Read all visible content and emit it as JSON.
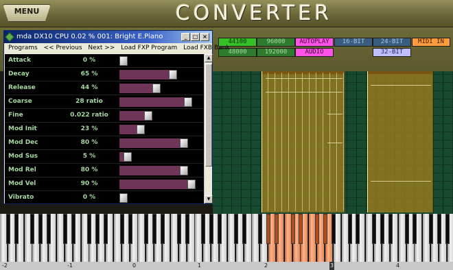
{
  "header": {
    "menu_label": "MENU",
    "title": "CONVERTER"
  },
  "options": {
    "row1": [
      "44100",
      "96000",
      "AUTOPLAY",
      "16-BIT",
      "24-BIT",
      "MIDI IN"
    ],
    "row2": [
      "48000",
      "192000",
      "AUDIO",
      "32-BIT"
    ],
    "selected": [
      "44100",
      "AUTOPLAY",
      "AUDIO",
      "32-BIT",
      "MIDI IN"
    ]
  },
  "plugin": {
    "title": "mda DX10   CPU  0.02 %   001: Bright E.Piano",
    "window_buttons": [
      "_",
      "□",
      "×"
    ],
    "menu": [
      "Programs",
      "<< Previous",
      "Next >>",
      "Load FXP Program",
      "Load FXB Bank"
    ],
    "params": [
      {
        "name": "Attack",
        "value": "0 %",
        "level": 0.0
      },
      {
        "name": "Decay",
        "value": "65 %",
        "level": 0.65
      },
      {
        "name": "Release",
        "value": "44 %",
        "level": 0.44
      },
      {
        "name": "Coarse",
        "value": "28 ratio",
        "level": 0.85
      },
      {
        "name": "Fine",
        "value": "0.022 ratio",
        "level": 0.33
      },
      {
        "name": "Mod Init",
        "value": "23 %",
        "level": 0.23
      },
      {
        "name": "Mod Dec",
        "value": "80 %",
        "level": 0.8
      },
      {
        "name": "Mod Sus",
        "value": "5 %",
        "level": 0.05
      },
      {
        "name": "Mod Rel",
        "value": "80 %",
        "level": 0.8
      },
      {
        "name": "Mod Vel",
        "value": "90 %",
        "level": 0.9
      },
      {
        "name": "Vibrato",
        "value": "0 %",
        "level": 0.0
      }
    ]
  },
  "keyboard": {
    "octave_labels": [
      "-2",
      "-1",
      "0",
      "1",
      "2",
      "3",
      "4"
    ],
    "highlighted_octave": "3"
  },
  "colors": {
    "grid": "#174a2e",
    "note_block": "#aa821e",
    "slider_fill": "#6f3558",
    "param_text": "#a8d9a2",
    "highlight_key": "#ff9a6a"
  }
}
